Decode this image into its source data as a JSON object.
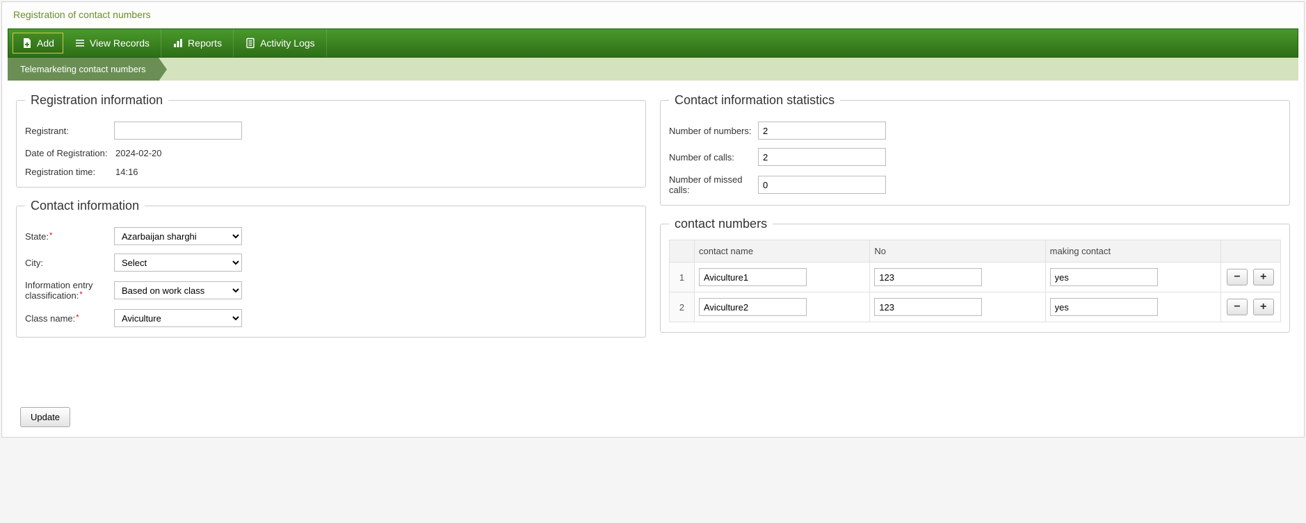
{
  "page": {
    "title": "Registration of contact numbers"
  },
  "toolbar": {
    "add": "Add",
    "view_records": "View Records",
    "reports": "Reports",
    "activity_logs": "Activity Logs"
  },
  "breadcrumb": {
    "current": "Telemarketing contact numbers"
  },
  "registration_info": {
    "legend": "Registration information",
    "registrant_label": "Registrant:",
    "registrant_value": "",
    "date_label": "Date of Registration:",
    "date_value": "2024-02-20",
    "time_label": "Registration time:",
    "time_value": "14:16"
  },
  "contact_info": {
    "legend": "Contact information",
    "state_label": "State:",
    "state_value": "Azarbaijan sharghi",
    "city_label": "City:",
    "city_value": "Select",
    "classification_label": "Information entry classification:",
    "classification_value": "Based on work class",
    "class_name_label": "Class name:",
    "class_name_value": "Aviculture"
  },
  "stats": {
    "legend": "Contact information statistics",
    "num_numbers_label": "Number of numbers:",
    "num_numbers_value": "2",
    "num_calls_label": "Number of calls:",
    "num_calls_value": "2",
    "num_missed_label": "Number of missed calls:",
    "num_missed_value": "0"
  },
  "contact_numbers": {
    "legend": "contact numbers",
    "headers": {
      "name": "contact name",
      "no": "No",
      "making_contact": "making contact"
    },
    "rows": [
      {
        "idx": "1",
        "name": "Aviculture1",
        "no": "123",
        "making": "yes"
      },
      {
        "idx": "2",
        "name": "Aviculture2",
        "no": "123",
        "making": "yes"
      }
    ]
  },
  "footer": {
    "update": "Update"
  }
}
